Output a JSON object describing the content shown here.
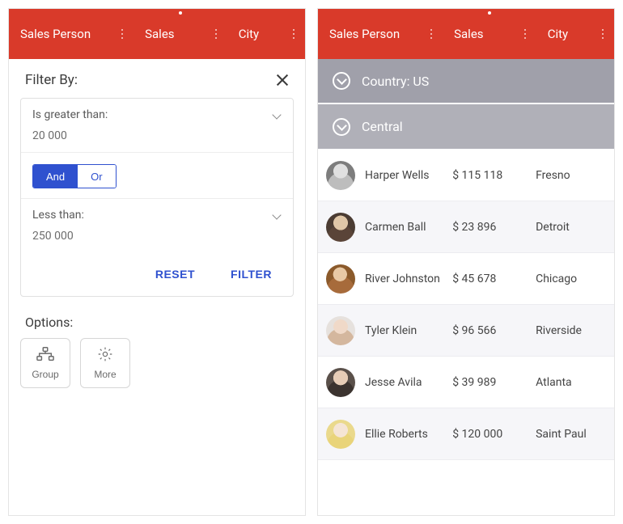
{
  "header": {
    "cols": [
      "Sales Person",
      "Sales",
      "City"
    ]
  },
  "filter": {
    "title": "Filter By:",
    "op1": "Is greater than:",
    "val1": "20 000",
    "logic_and": "And",
    "logic_or": "Or",
    "op2": "Less than:",
    "val2": "250 000",
    "reset": "RESET",
    "apply": "FILTER"
  },
  "options": {
    "title": "Options:",
    "group": "Group",
    "more": "More"
  },
  "grid": {
    "group0": "Country: US",
    "group1": "Central",
    "rows": [
      {
        "name": "Harper Wells",
        "sales": "$ 115 118",
        "city": "Fresno"
      },
      {
        "name": "Carmen Ball",
        "sales": "$ 23 896",
        "city": "Detroit"
      },
      {
        "name": "River Johnston",
        "sales": "$ 45 678",
        "city": "Chicago"
      },
      {
        "name": "Tyler Klein",
        "sales": "$ 96 566",
        "city": "Riverside"
      },
      {
        "name": "Jesse Avila",
        "sales": "$ 39 989",
        "city": "Atlanta"
      },
      {
        "name": "Ellie Roberts",
        "sales": "$ 120 000",
        "city": "Saint Paul"
      }
    ]
  }
}
